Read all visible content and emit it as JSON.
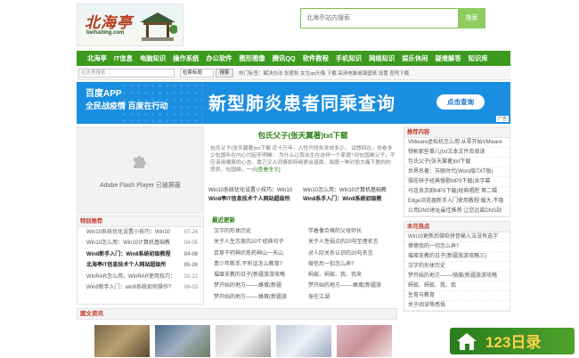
{
  "header": {
    "logo_text": "北海亭",
    "logo_sub": "beihaiting.com",
    "search_placeholder": "北海亭站内搜索",
    "search_button": "搜索"
  },
  "nav": [
    "北海亭",
    "IT信息",
    "电脑知识",
    "操作系统",
    "办公软件",
    "图形图像",
    "腾讯QQ",
    "软件教程",
    "手机知识",
    "网络知识",
    "娱乐休闲",
    "疑难解答",
    "知识库"
  ],
  "subbar": {
    "input_placeholder": "在这里搜索…",
    "select_value": "检索标题",
    "button": "搜索",
    "hot_label": "热门标签：",
    "hot_text": "解决办法 张君秋 女生qq头像 下载 高清电脑桌面壁纸 设置 查阿下载"
  },
  "banner": {
    "app": "百度APP",
    "slogan": "全民战疫情 百度在行动",
    "headline": "新型肺炎患者同乘查询",
    "cta": "点击查询",
    "ad": "广告"
  },
  "flash": {
    "label": "Adobe Flash Player 已被屏蔽"
  },
  "article": {
    "title": "包氏父子(张天翼著)txt下载",
    "desc": "包氏父子(张天翼著)txt下载 近十万年，人性开段失来效多少。 试想回在，命卷多少包国年在内心付起天明确： 为什么让我出生在这样一个家庭?对包国维父子，不应该用嘲笑的心态，靠己又人同情和特纲更会道面，局感一种对愈大痛下教的的悲哀，包国维，一点",
    "more": "[查看全文]"
  },
  "article_links": [
    [
      "Win10系统优化设置小技巧：Win10",
      "Win10怎么用：Win10计算机基础教"
    ],
    [
      "Win8亭IT信息技术个人网站超级所",
      "Win8系手入门：Win8系统初级教"
    ]
  ],
  "latest_head": "最近更新",
  "latest": [
    [
      "汉字的形体历史",
      "学着像合格的父母师长"
    ],
    [
      "关于人生志美的20个经典句子",
      "关于人性弱点的20句至理名言"
    ],
    [
      "百草干药神农炼药神山一天山",
      "对人际关系认识的20句名言"
    ],
    [
      "青少年断手,不听话怎么教育?",
      "微信后一扣怎么弄?"
    ],
    [
      "璀璨支教的日子(新疆旅游攻略",
      "蚂蚁、蚂蚁、我、我来"
    ],
    [
      "梦开始的地方——-蜂蛋(新疆",
      "梦开始的地方——-蜂蛋(新疆旅"
    ],
    [
      "梦开始的地方——-蜂蛋(新疆旅",
      "身在江湖"
    ]
  ],
  "special": {
    "head": "特别推荐",
    "items": [
      {
        "t": "Win10系统优化设置小技巧：Win10",
        "d": "07-24",
        "b": false
      },
      {
        "t": "Win10怎么用：Win10计算机基础教",
        "d": "04-05",
        "b": false
      },
      {
        "t": "Win8新手入门：Win8系统初级教程",
        "d": "04-08",
        "b": true
      },
      {
        "t": "北海亭IT信息技术个人网站超级所",
        "d": "05-26",
        "b": true
      },
      {
        "t": "WinRAR怎么用，WinRAR使用技巧：",
        "d": "02-12",
        "b": false
      },
      {
        "t": "Win8新手入门：win8系统如何操作?",
        "d": "09-03",
        "b": false
      }
    ]
  },
  "recommend": {
    "head": "推荐内容",
    "items": [
      "VMware虚拟机怎么用:从零开始VMware",
      "韧彬那些事儿(txt文本文件及阅读",
      "包氏父子(张天翼著)txt下载",
      "世界名著：苏联时代(Word版TXT版)",
      "骆驼祥子经典慢歌MP3下载(含字幕",
      "马连良京剧MP3下载(经典唱腔 第二辑",
      "Edge浏览器新手入门使用教程:缓大,不隐",
      "公用DNS地址最佳推荐:让您远离DNS劫"
    ]
  },
  "monthly": {
    "head": "本月热点",
    "items": [
      "Win10更新后微软拼音输入法没有选字",
      "擦擦我的一切怎么弄?",
      "璀璨支教的日子(新疆旅游攻略三)",
      "汉字的形体历史",
      "梦开始的地方——-骑蛋(新疆旅游攻略",
      "蚂蚁、蚂蚁、我、我",
      "生育与教育",
      "关于阅读等感悟"
    ]
  },
  "pics": {
    "head": "图文资讯"
  },
  "watermark": {
    "text": "123日录"
  }
}
